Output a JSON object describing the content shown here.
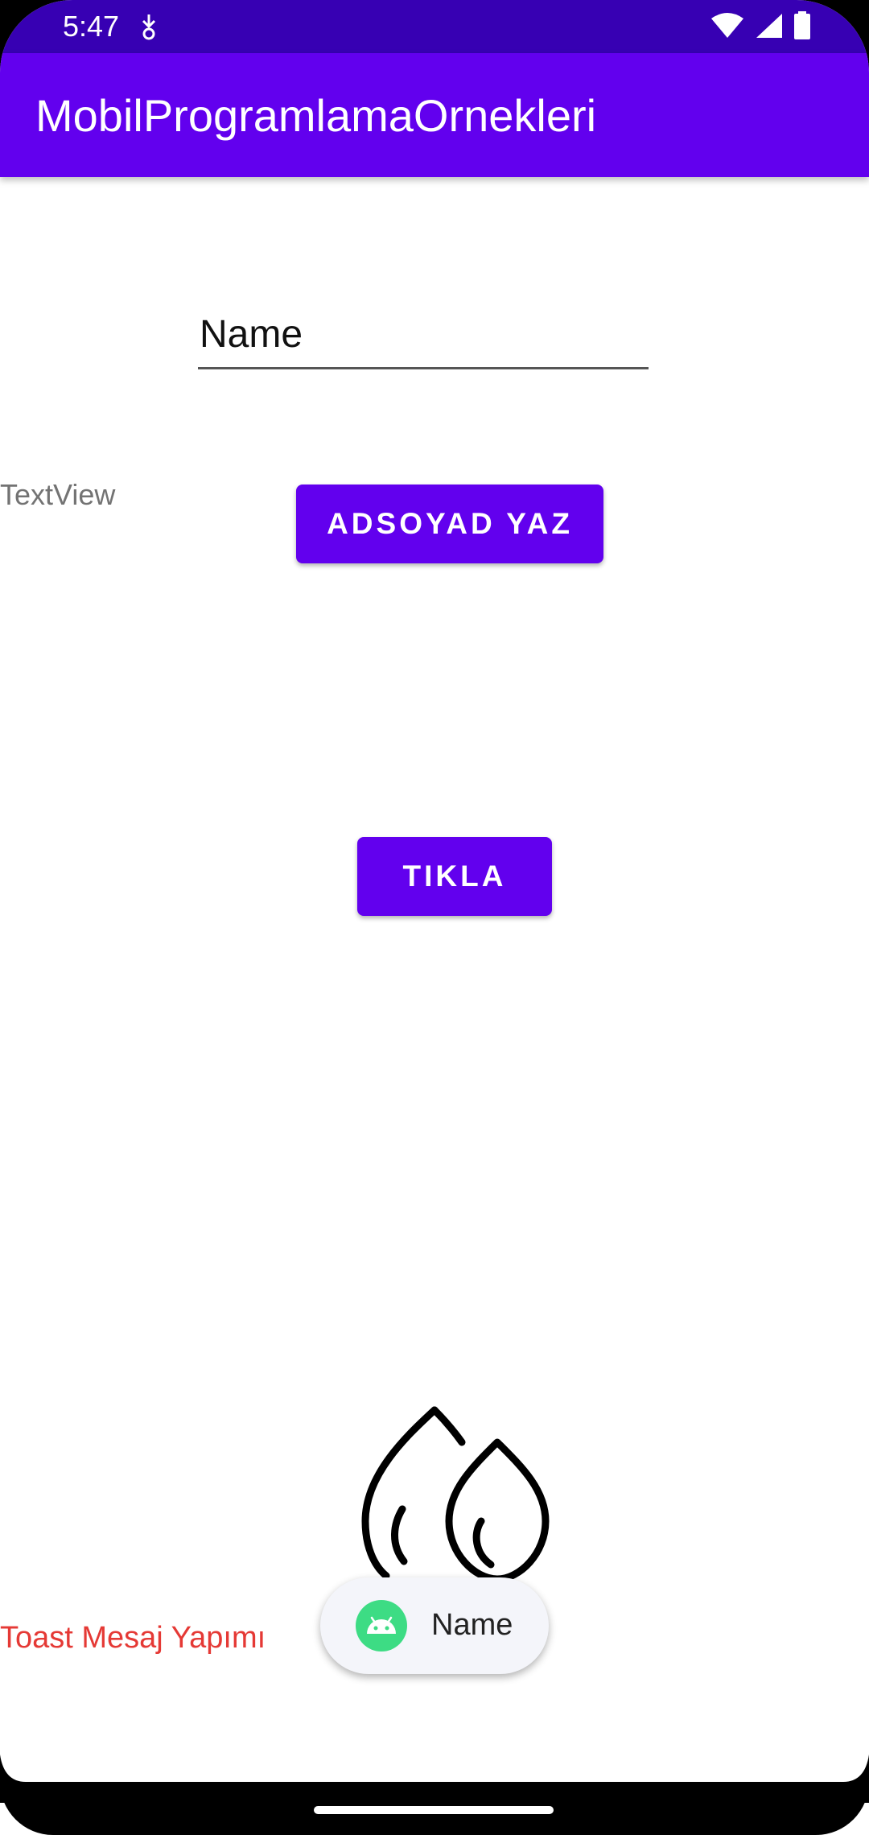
{
  "status_bar": {
    "time": "5:47",
    "left_icon": "download-notification-icon",
    "right_icons": [
      "wifi-icon",
      "signal-icon",
      "battery-icon"
    ],
    "background": "#3700B3"
  },
  "app_bar": {
    "title": "MobilProgramlamaOrnekleri",
    "background": "#6200EE"
  },
  "form": {
    "name_value": "Name",
    "text_view": "TextView",
    "adsoyad_button": "ADSOYAD YAZ",
    "tikla_button": "TIKLA",
    "button_color": "#6200EE"
  },
  "image": {
    "icon": "water-drops-icon"
  },
  "toast_section": {
    "label": "Toast Mesaj Yapımı",
    "label_color": "#E53935"
  },
  "toast": {
    "icon": "android-icon",
    "text": "Name"
  },
  "nav_bar": {
    "handle": "home-handle"
  }
}
